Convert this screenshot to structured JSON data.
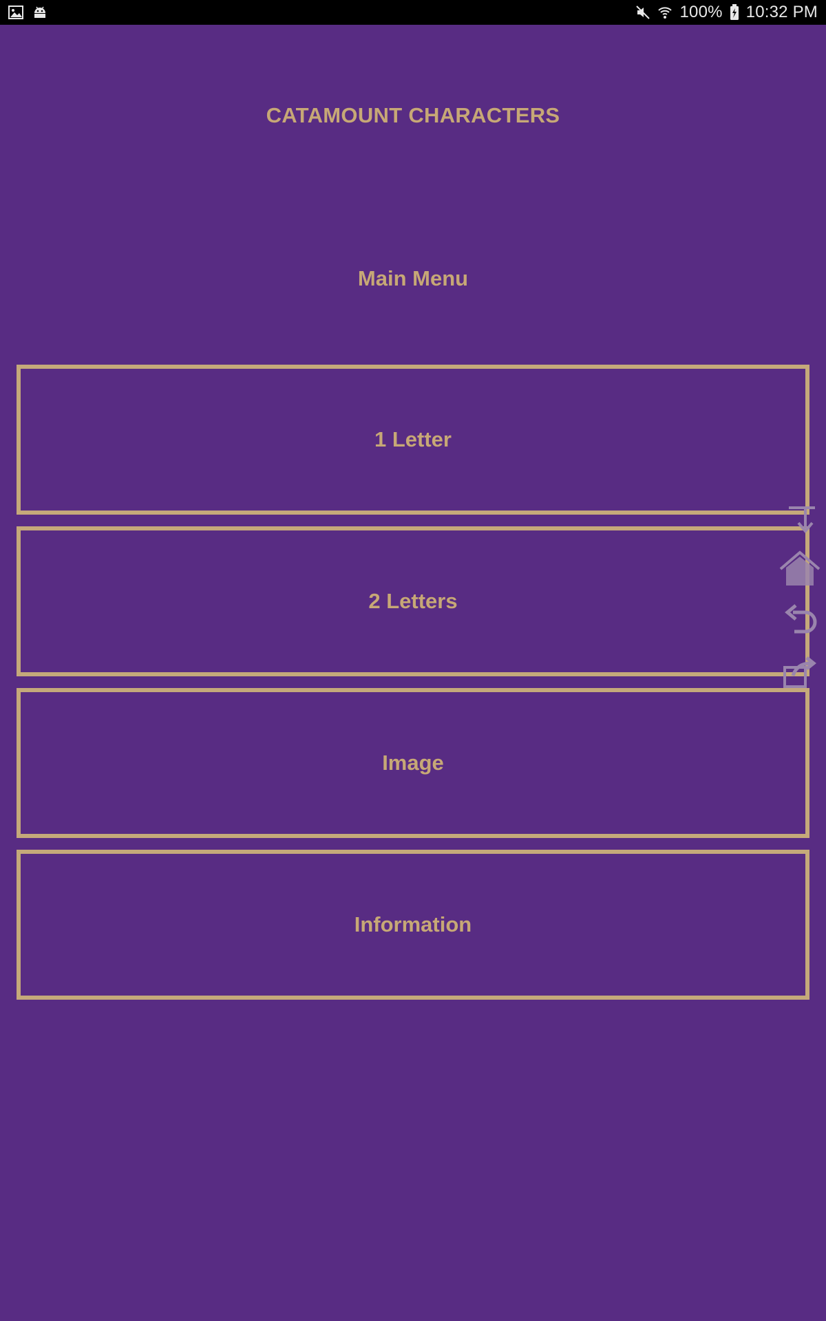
{
  "status_bar": {
    "left_icons": [
      "gallery-icon",
      "android-debug-icon"
    ],
    "right_icons": [
      "mute-icon",
      "wifi-icon",
      "battery-charging-icon"
    ],
    "battery": "100%",
    "time": "10:32 PM"
  },
  "app": {
    "title": "CATAMOUNT CHARACTERS",
    "menu_heading": "Main Menu"
  },
  "menu": {
    "items": [
      {
        "label": "1 Letter"
      },
      {
        "label": "2 Letters"
      },
      {
        "label": "Image"
      },
      {
        "label": "Information"
      }
    ]
  },
  "floating_toolbar": {
    "icons": [
      "download-icon",
      "home-icon",
      "undo-icon",
      "share-icon"
    ]
  },
  "colors": {
    "background": "#582c83",
    "accent_gold": "#c5a97a",
    "status_bar": "#000000"
  }
}
